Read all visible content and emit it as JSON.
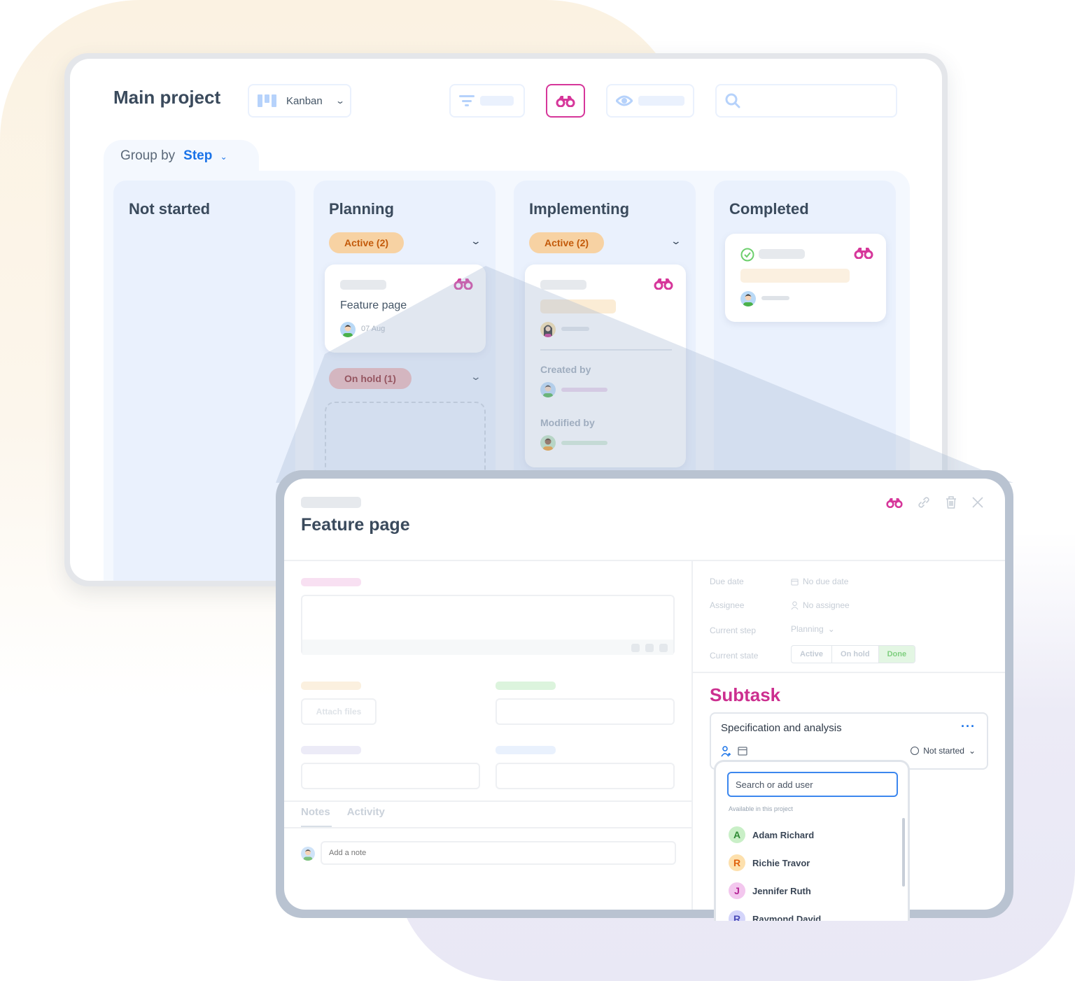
{
  "colors": {
    "accent_magenta": "#d6369a",
    "accent_blue": "#1a73e8",
    "active_pill_bg": "#f7d2a3",
    "active_pill_text": "#c35a0a",
    "hold_pill_bg": "#ebb4b6",
    "hold_pill_text": "#8b1f23",
    "done_green": "#7fcf7f"
  },
  "header": {
    "title": "Main project",
    "view_selector": {
      "label": "Kanban",
      "icon": "kanban-icon"
    },
    "toolbar": {
      "filter_icon": "filter-icon",
      "binoculars_icon": "binoculars-icon",
      "eye_icon": "eye-icon",
      "search_icon": "search-icon"
    }
  },
  "group_by": {
    "label": "Group by",
    "value": "Step"
  },
  "columns": [
    {
      "title": "Not started"
    },
    {
      "title": "Planning",
      "groups": [
        {
          "label": "Active (2)"
        },
        {
          "label": "On hold (1)"
        }
      ],
      "card": {
        "title": "Feature page",
        "date": "07 Aug"
      }
    },
    {
      "title": "Implementing",
      "groups": [
        {
          "label": "Active (2)"
        }
      ],
      "card": {
        "created_by_label": "Created by",
        "modified_by_label": "Modified by"
      }
    },
    {
      "title": "Completed"
    }
  ],
  "task_detail": {
    "title": "Feature page",
    "actions": [
      "binoculars-icon",
      "link-icon",
      "trash-icon",
      "close-icon"
    ],
    "attach_label": "Attach files",
    "tabs": [
      "Notes",
      "Activity"
    ],
    "note_placeholder": "Add a note",
    "properties": {
      "due_date_label": "Due date",
      "due_date_value": "No due date",
      "assignee_label": "Assignee",
      "assignee_value": "No assignee",
      "step_label": "Current  step",
      "step_value": "Planning",
      "state_label": "Current  state",
      "states": [
        "Active",
        "On hold",
        "Done"
      ],
      "selected_state": "Done"
    },
    "subtask": {
      "heading": "Subtask",
      "name": "Specification and analysis",
      "status": "Not started",
      "more_icon": "ellipsis-icon"
    },
    "user_picker": {
      "placeholder": "Search or add user",
      "section_label": "Available in this project",
      "users": [
        {
          "initial": "A",
          "name": "Adam Richard",
          "bg": "#c9efc7",
          "fg": "#2f8a35"
        },
        {
          "initial": "R",
          "name": "Richie Travor",
          "bg": "#fde0ad",
          "fg": "#e0620e"
        },
        {
          "initial": "J",
          "name": "Jennifer Ruth",
          "bg": "#f3c7ee",
          "fg": "#b52597"
        },
        {
          "initial": "R",
          "name": "Raymond David",
          "bg": "#d4d5fa",
          "fg": "#4a4bb8"
        }
      ]
    }
  }
}
